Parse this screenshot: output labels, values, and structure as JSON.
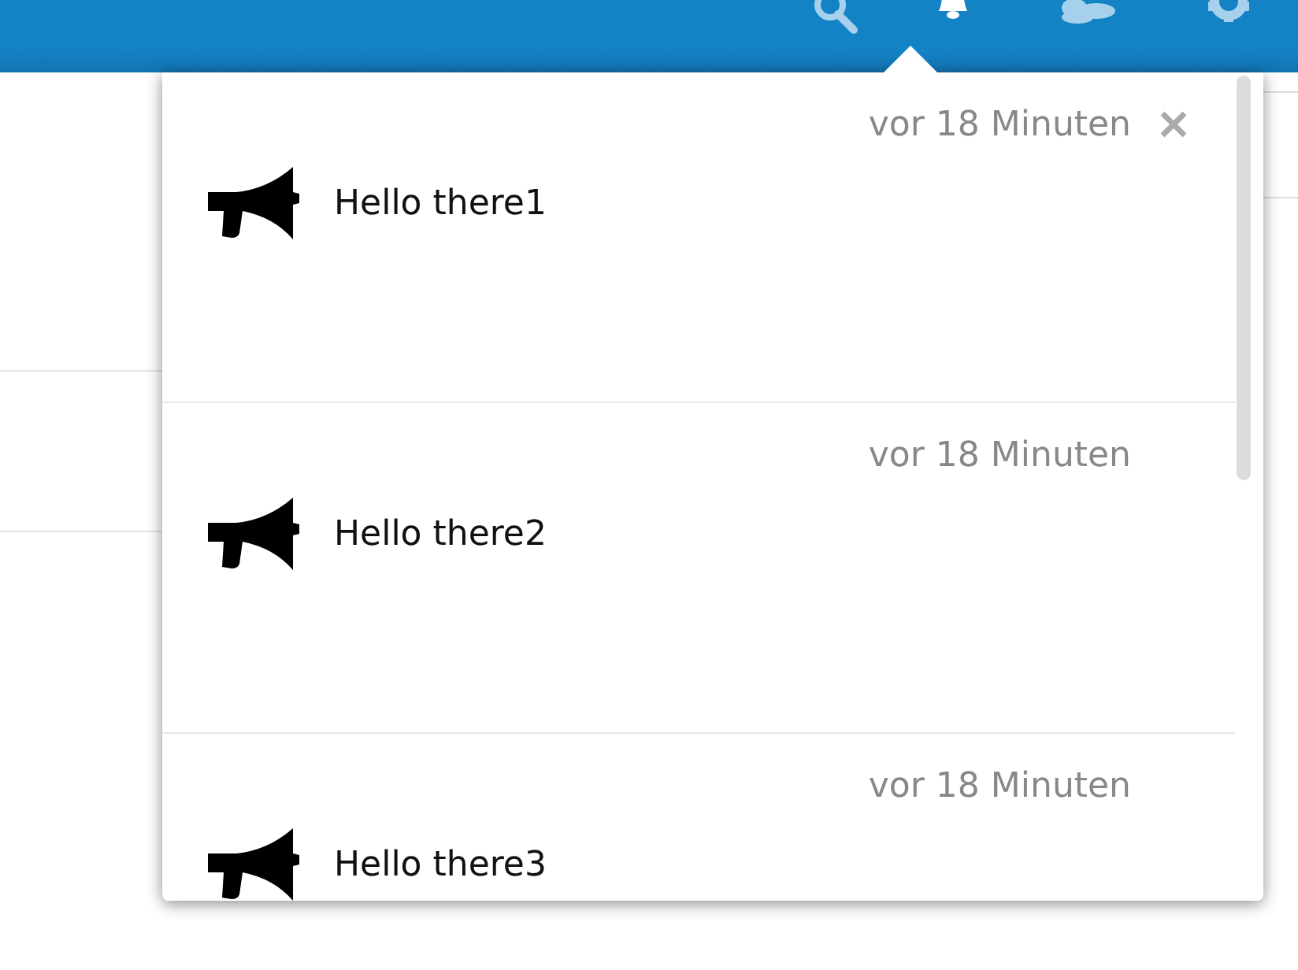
{
  "header": {
    "icons": [
      {
        "kind": "search",
        "selected": false
      },
      {
        "kind": "bell",
        "selected": true
      },
      {
        "kind": "contacts",
        "selected": false
      },
      {
        "kind": "gear",
        "selected": false
      }
    ]
  },
  "notifications": [
    {
      "time": "vor 18 Minuten",
      "message": "Hello there1",
      "dismiss_visible": true
    },
    {
      "time": "vor 18 Minuten",
      "message": "Hello there2",
      "dismiss_visible": false
    },
    {
      "time": "vor 18 Minuten",
      "message": "Hello there3",
      "dismiss_visible": false
    }
  ]
}
